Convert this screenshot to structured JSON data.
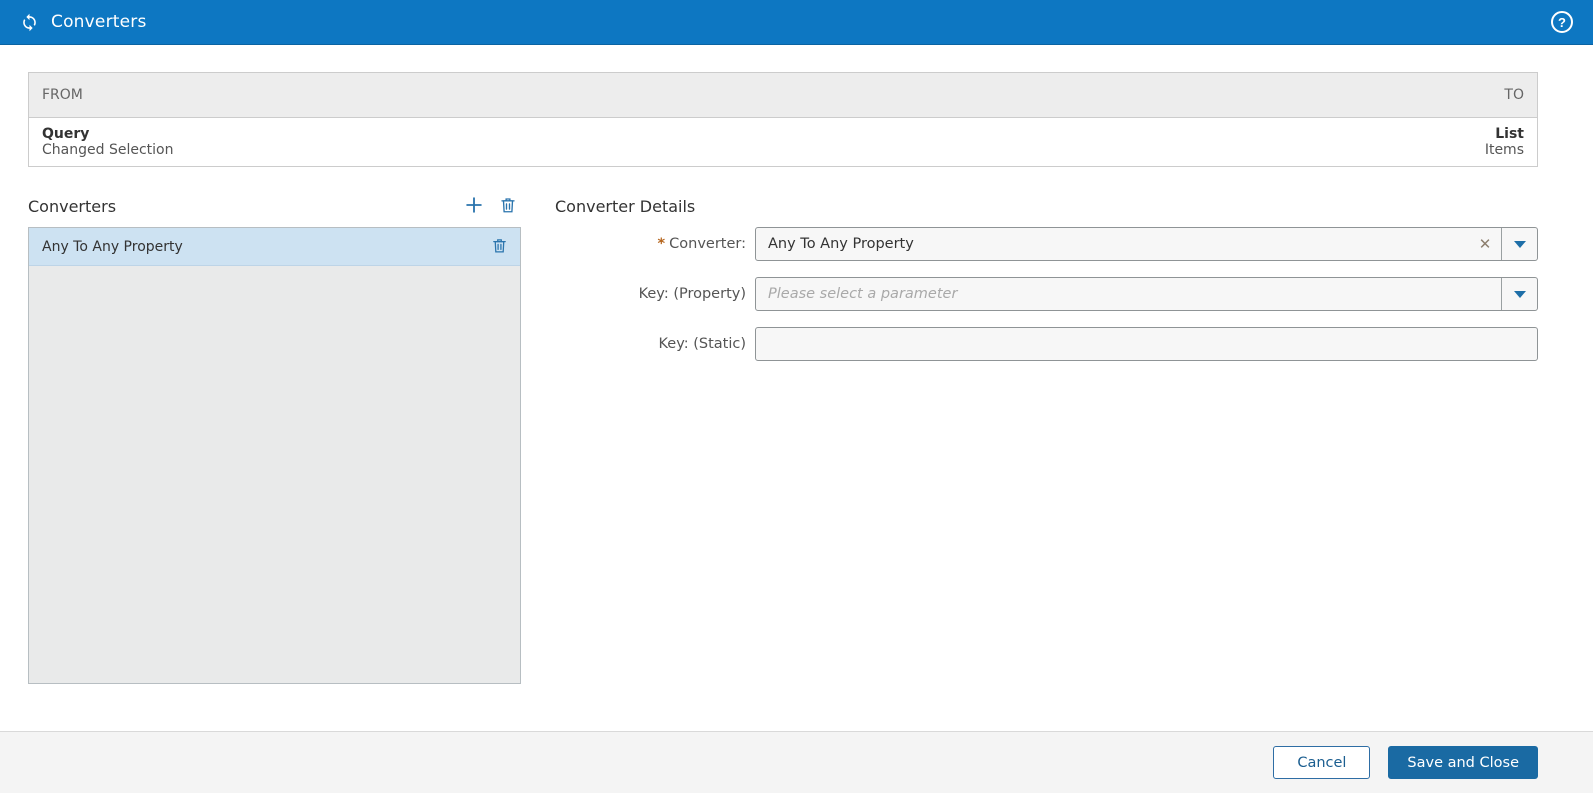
{
  "header": {
    "title": "Converters",
    "app_icon": "sync-icon",
    "help_icon": "help-icon",
    "help_glyph": "?"
  },
  "mapping_table": {
    "from_header": "FROM",
    "to_header": "TO",
    "row": {
      "from_primary": "Query",
      "from_secondary": "Changed Selection",
      "to_primary": "List",
      "to_secondary": "Items"
    }
  },
  "converters_panel": {
    "title": "Converters",
    "add_icon": "plus-icon",
    "delete_icon": "trash-icon",
    "items": [
      {
        "label": "Any To Any Property",
        "selected": true
      }
    ]
  },
  "details_panel": {
    "title": "Converter Details",
    "required_marker": "*",
    "clear_glyph": "✕",
    "fields": [
      {
        "label": "Converter:",
        "required": true,
        "value": "Any To Any Property",
        "placeholder": "",
        "has_clear": true,
        "has_dropdown": true
      },
      {
        "label": "Key: (Property)",
        "required": false,
        "value": "",
        "placeholder": "Please select a parameter",
        "has_clear": false,
        "has_dropdown": true
      },
      {
        "label": "Key: (Static)",
        "required": false,
        "value": "",
        "placeholder": "",
        "has_clear": false,
        "has_dropdown": false
      }
    ]
  },
  "footer": {
    "cancel_label": "Cancel",
    "save_label": "Save and Close"
  },
  "colors": {
    "header_blue": "#0d77c2",
    "primary_button_blue": "#1a6aa3",
    "icon_blue": "#2a74ad",
    "selected_row_blue": "#cde2f2",
    "required_marker_orange": "#b5651d",
    "table_header_gray": "#ededed",
    "list_background_gray": "#e9eaea",
    "footer_gray": "#f4f4f4"
  }
}
